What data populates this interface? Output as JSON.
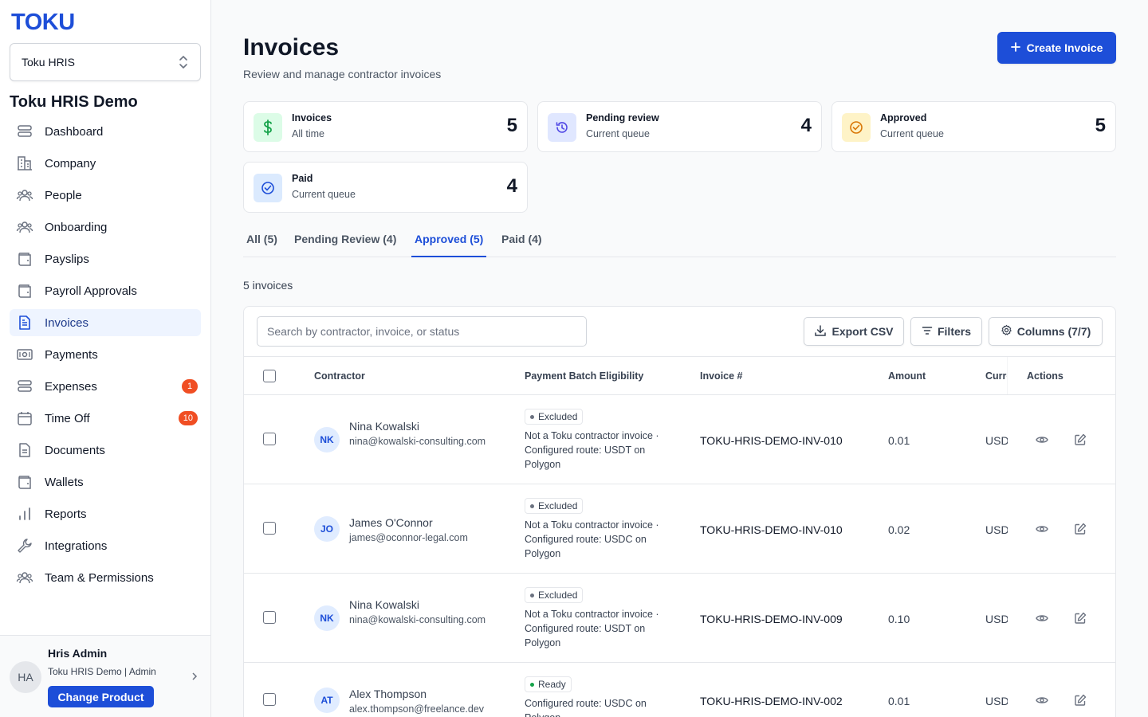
{
  "sidebar": {
    "logo": "TOKU",
    "product_select": "Toku HRIS",
    "org_name": "Toku HRIS Demo",
    "items": [
      {
        "label": "Dashboard",
        "icon": "dashboard-icon"
      },
      {
        "label": "Company",
        "icon": "building-icon"
      },
      {
        "label": "People",
        "icon": "people-icon"
      },
      {
        "label": "Onboarding",
        "icon": "onboarding-icon"
      },
      {
        "label": "Payslips",
        "icon": "wallet-icon"
      },
      {
        "label": "Payroll Approvals",
        "icon": "wallet-icon"
      },
      {
        "label": "Invoices",
        "icon": "document-icon",
        "active": true
      },
      {
        "label": "Payments",
        "icon": "cash-icon"
      },
      {
        "label": "Expenses",
        "icon": "expenses-icon",
        "badge": "1"
      },
      {
        "label": "Time Off",
        "icon": "calendar-icon",
        "badge": "10"
      },
      {
        "label": "Documents",
        "icon": "file-icon"
      },
      {
        "label": "Wallets",
        "icon": "wallet-icon"
      },
      {
        "label": "Reports",
        "icon": "bar-chart-icon"
      },
      {
        "label": "Integrations",
        "icon": "wrench-icon"
      },
      {
        "label": "Team & Permissions",
        "icon": "people-icon"
      }
    ],
    "user": {
      "initials": "HA",
      "name": "Hris Admin",
      "org": "Toku HRIS Demo | Admin",
      "change_label": "Change Product"
    }
  },
  "header": {
    "title": "Invoices",
    "subtitle": "Review and manage contractor invoices",
    "create_label": "Create Invoice"
  },
  "stats": [
    {
      "label": "Invoices",
      "sub": "All time",
      "value": "5",
      "icon": "dollar-icon",
      "bg": "#dcfce7",
      "fg": "#16a34a"
    },
    {
      "label": "Pending review",
      "sub": "Current queue",
      "value": "4",
      "icon": "history-icon",
      "bg": "#e0e7ff",
      "fg": "#4f46e5"
    },
    {
      "label": "Approved",
      "sub": "Current queue",
      "value": "5",
      "icon": "check-circle-icon",
      "bg": "#fef3c7",
      "fg": "#d97706"
    },
    {
      "label": "Paid",
      "sub": "Current queue",
      "value": "4",
      "icon": "check-circle-icon",
      "bg": "#dbeafe",
      "fg": "#1d4ed8"
    }
  ],
  "tabs": [
    {
      "label": "All (5)"
    },
    {
      "label": "Pending Review (4)"
    },
    {
      "label": "Approved (5)",
      "active": true
    },
    {
      "label": "Paid (4)"
    }
  ],
  "count_text": "5 invoices",
  "toolbar": {
    "search_placeholder": "Search by contractor, invoice, or status",
    "export_label": "Export CSV",
    "filters_label": "Filters",
    "columns_label": "Columns (7/7)"
  },
  "table": {
    "columns": [
      "Contractor",
      "Payment Batch Eligibility",
      "Invoice #",
      "Amount",
      "Currency",
      "Actions"
    ],
    "rows": [
      {
        "initials": "NK",
        "name": "Nina Kowalski",
        "email": "nina@kowalski-consulting.com",
        "status": "Excluded",
        "eligibility": "Not a Toku contractor invoice · Configured route: USDT on Polygon",
        "invoice": "TOKU-HRIS-DEMO-INV-010",
        "amount": "0.01",
        "currency": "USDT"
      },
      {
        "initials": "JO",
        "name": "James O'Connor",
        "email": "james@oconnor-legal.com",
        "status": "Excluded",
        "eligibility": "Not a Toku contractor invoice · Configured route: USDC on Polygon",
        "invoice": "TOKU-HRIS-DEMO-INV-010",
        "amount": "0.02",
        "currency": "USDC"
      },
      {
        "initials": "NK",
        "name": "Nina Kowalski",
        "email": "nina@kowalski-consulting.com",
        "status": "Excluded",
        "eligibility": "Not a Toku contractor invoice · Configured route: USDT on Polygon",
        "invoice": "TOKU-HRIS-DEMO-INV-009",
        "amount": "0.10",
        "currency": "USDT"
      },
      {
        "initials": "AT",
        "name": "Alex Thompson",
        "email": "alex.thompson@freelance.dev",
        "status": "Ready",
        "eligibility": "Configured route: USDC on Polygon",
        "invoice": "TOKU-HRIS-DEMO-INV-002",
        "amount": "0.01",
        "currency": "USDC"
      }
    ]
  },
  "colors": {
    "accent": "#1d4ed8",
    "badge": "#f04e23",
    "excluded_dot": "#6b7280",
    "ready_dot": "#16a34a"
  }
}
